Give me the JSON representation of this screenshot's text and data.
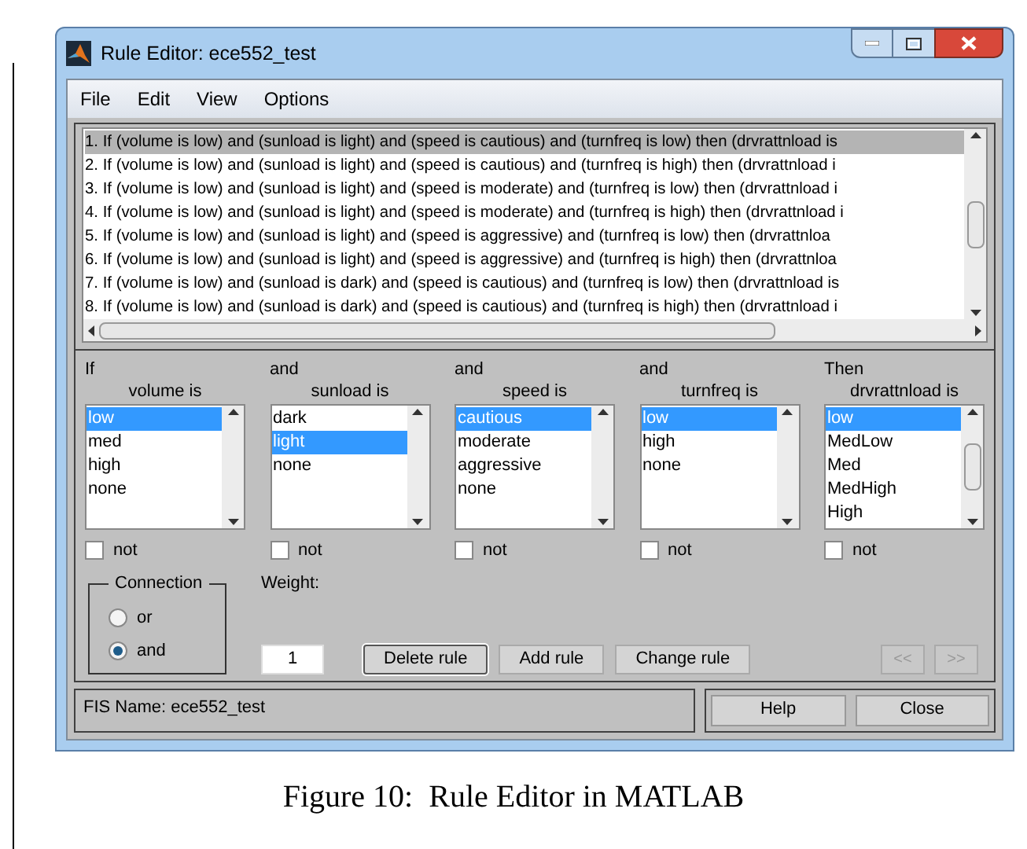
{
  "window": {
    "title": "Rule Editor: ece552_test"
  },
  "menu": [
    {
      "label": "File"
    },
    {
      "label": "Edit"
    },
    {
      "label": "View"
    },
    {
      "label": "Options"
    }
  ],
  "rules": [
    {
      "text": "1. If (volume is low) and (sunload is light) and (speed is cautious) and (turnfreq is low) then (drvrattnload is",
      "selected": true
    },
    {
      "text": "2. If (volume is low) and (sunload is light) and (speed is cautious) and (turnfreq is high) then (drvrattnload i",
      "selected": false
    },
    {
      "text": "3. If (volume is low) and (sunload is light) and (speed is moderate) and (turnfreq is low) then (drvrattnload i",
      "selected": false
    },
    {
      "text": "4. If (volume is low) and (sunload is light) and (speed is moderate) and (turnfreq is high) then (drvrattnload i",
      "selected": false
    },
    {
      "text": "5. If (volume is low) and (sunload is light) and (speed is aggressive) and (turnfreq is low) then (drvrattnloa",
      "selected": false
    },
    {
      "text": "6. If (volume is low) and (sunload is light) and (speed is aggressive) and (turnfreq is high) then (drvrattnloa",
      "selected": false
    },
    {
      "text": "7. If (volume is low) and (sunload is dark) and (speed is cautious) and (turnfreq is low) then (drvrattnload is",
      "selected": false
    },
    {
      "text": "8. If (volume is low) and (sunload is dark) and (speed is cautious) and (turnfreq is high) then (drvrattnload i",
      "selected": false
    }
  ],
  "variables": [
    {
      "connector": "If",
      "label": "volume is",
      "options": [
        {
          "text": "low",
          "selected": true
        },
        {
          "text": "med",
          "selected": false
        },
        {
          "text": "high",
          "selected": false
        },
        {
          "text": "none",
          "selected": false
        }
      ],
      "not_label": "not",
      "not_checked": false
    },
    {
      "connector": "and",
      "label": "sunload is",
      "options": [
        {
          "text": "dark",
          "selected": false
        },
        {
          "text": "light",
          "selected": true
        },
        {
          "text": "none",
          "selected": false
        }
      ],
      "not_label": "not",
      "not_checked": false
    },
    {
      "connector": "and",
      "label": "speed is",
      "options": [
        {
          "text": "cautious",
          "selected": true
        },
        {
          "text": "moderate",
          "selected": false
        },
        {
          "text": "aggressive",
          "selected": false
        },
        {
          "text": "none",
          "selected": false
        }
      ],
      "not_label": "not",
      "not_checked": false
    },
    {
      "connector": "and",
      "label": "turnfreq is",
      "options": [
        {
          "text": "low",
          "selected": true
        },
        {
          "text": "high",
          "selected": false
        },
        {
          "text": "none",
          "selected": false
        }
      ],
      "not_label": "not",
      "not_checked": false
    },
    {
      "connector": "Then",
      "label": "drvrattnload is",
      "options": [
        {
          "text": "low",
          "selected": true
        },
        {
          "text": "MedLow",
          "selected": false
        },
        {
          "text": "Med",
          "selected": false
        },
        {
          "text": "MedHigh",
          "selected": false
        },
        {
          "text": "High",
          "selected": false
        }
      ],
      "not_label": "not",
      "not_checked": false
    }
  ],
  "connection": {
    "title": "Connection",
    "options": [
      {
        "label": "or",
        "selected": false
      },
      {
        "label": "and",
        "selected": true
      }
    ]
  },
  "weight": {
    "label": "Weight:",
    "value": "1"
  },
  "rule_buttons": [
    {
      "label": "Delete rule",
      "focused": true
    },
    {
      "label": "Add rule",
      "focused": false
    },
    {
      "label": "Change rule",
      "focused": false
    }
  ],
  "nav_buttons": [
    {
      "label": "<<",
      "disabled": true
    },
    {
      "label": ">>",
      "disabled": true
    }
  ],
  "status": "FIS Name: ece552_test",
  "footer_buttons": [
    {
      "label": "Help"
    },
    {
      "label": "Close"
    }
  ],
  "caption": "Figure 10:  Rule Editor in MATLAB"
}
